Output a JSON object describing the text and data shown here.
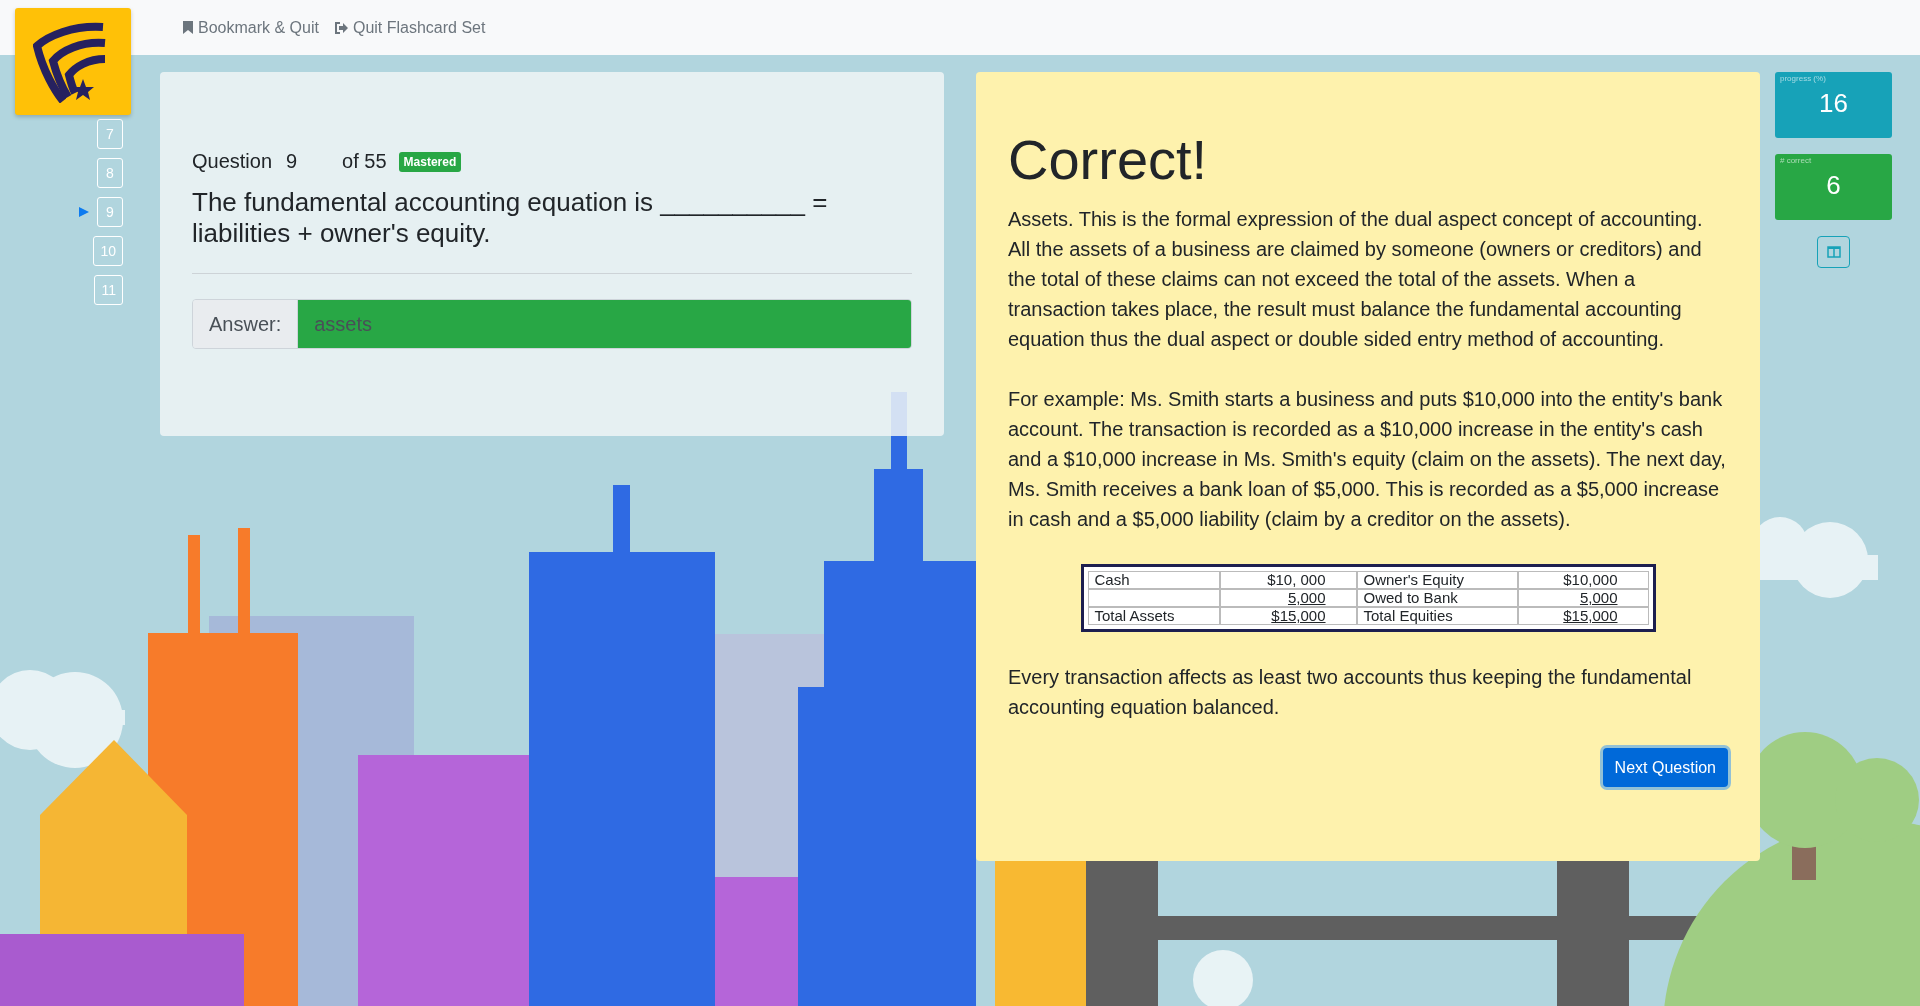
{
  "header": {
    "links": [
      {
        "label": "Bookmark & Quit"
      },
      {
        "label": "Quit Flashcard Set"
      }
    ]
  },
  "question_nav": [
    {
      "label": "7",
      "selected": false
    },
    {
      "label": "8",
      "selected": false
    },
    {
      "label": "9",
      "selected": true
    },
    {
      "label": "10",
      "selected": false
    },
    {
      "label": "11",
      "selected": false
    }
  ],
  "question": {
    "label": "Question",
    "number": "9",
    "of": "of 55",
    "badge": "Mastered",
    "text": "The fundamental accounting equation is __________ = liabilities + owner's equity.",
    "answer_label": "Answer:",
    "answer": "assets",
    "correct": true
  },
  "feedback": {
    "title": "Correct!",
    "paragraphs": [
      "Assets. This is the formal expression of the dual aspect concept of accounting. All the assets of a business are claimed by someone (owners or creditors) and the total of these claims can not exceed the total of the assets. When a transaction takes place, the result must balance the fundamental accounting equation thus the dual aspect or double sided entry method of accounting.",
      "For example: Ms. Smith starts a business and puts $10,000 into the entity's bank account. The transaction is recorded as a $10,000 increase in the entity's cash and a $10,000 increase in Ms. Smith's equity (claim on the assets). The next day, Ms. Smith receives a bank loan of $5,000. This is recorded as a $5,000 increase in cash and a $5,000 liability (claim by a creditor on the assets)."
    ],
    "table": [
      {
        "asset": "Cash",
        "asset_amount": "$10, 000",
        "equity": "Owner's Equity",
        "equity_amount": "$10,000",
        "underlined": false
      },
      {
        "asset_amount": "5,000",
        "equity": "Owed to Bank",
        "equity_amount": "5,000",
        "underlined": true
      },
      {
        "asset": "Total Assets",
        "asset_amount": "$15,000",
        "equity": "Total Equities",
        "equity_amount": "$15,000",
        "underlined": true
      }
    ],
    "closing": "Every transaction affects as least two accounts thus keeping the fundamental accounting equation balanced.",
    "button": "Next Question"
  },
  "stats": [
    {
      "label": "progress (%)",
      "value": "16",
      "color": "#17a2b8"
    },
    {
      "label": "# correct",
      "value": "6",
      "color": "#28a745"
    }
  ]
}
